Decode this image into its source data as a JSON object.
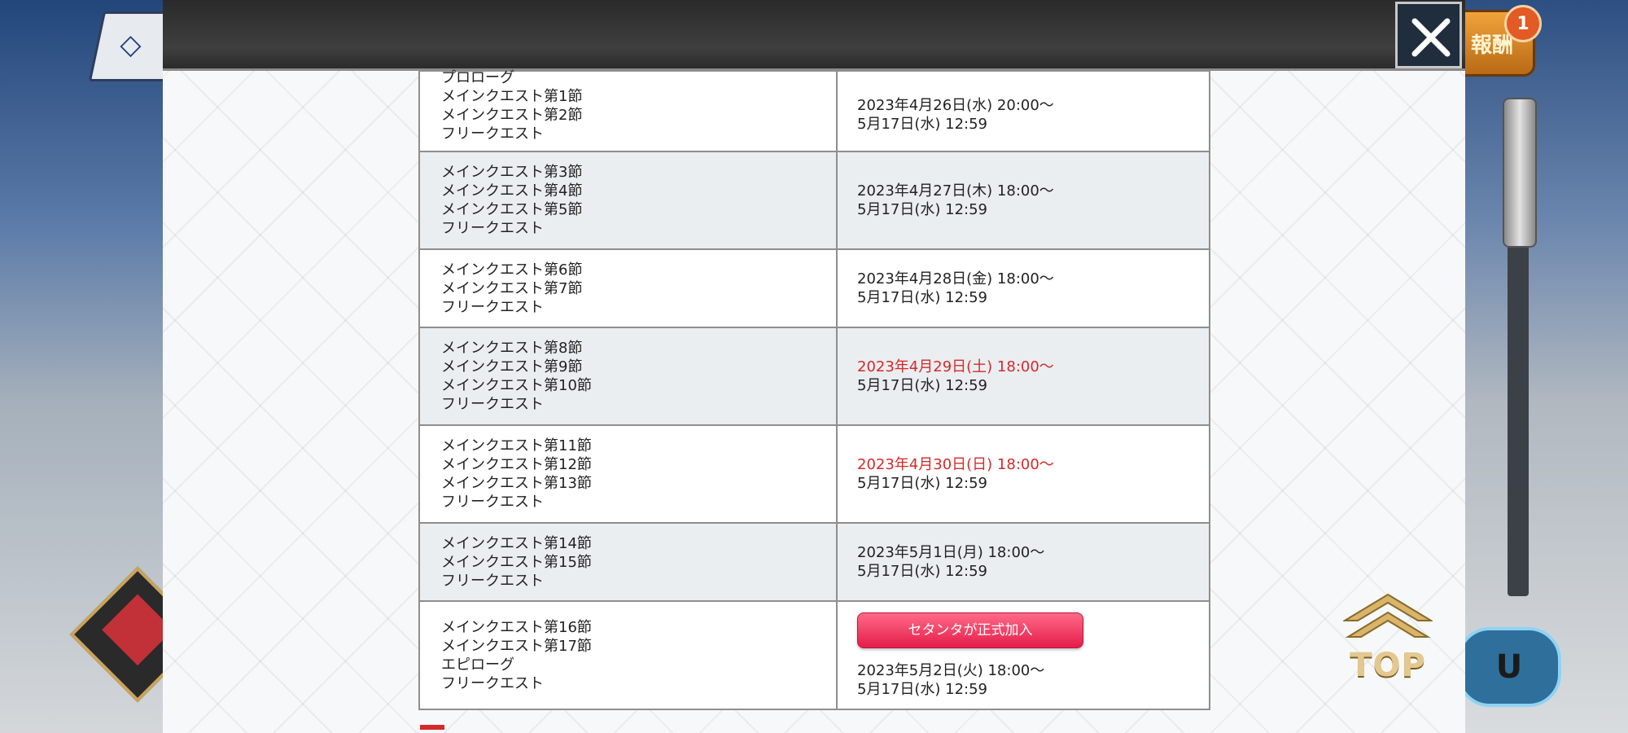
{
  "background": {
    "reward_label": "報酬",
    "reward_badge": "1",
    "menu_label": "U",
    "back_glyph": "◇"
  },
  "modal": {
    "close_icon": "close-x-icon"
  },
  "schedule": {
    "rows": [
      {
        "quests": [
          "プロローグ",
          "メインクエスト第1節",
          "メインクエスト第2節",
          "フリークエスト"
        ],
        "open": "2023年4月26日(水) 20:00〜",
        "close": "5月17日(水) 12:59"
      },
      {
        "quests": [
          "メインクエスト第3節",
          "メインクエスト第4節",
          "メインクエスト第5節",
          "フリークエスト"
        ],
        "open": "2023年4月27日(木) 18:00〜",
        "close": "5月17日(水) 12:59"
      },
      {
        "quests": [
          "メインクエスト第6節",
          "メインクエスト第7節",
          "フリークエスト"
        ],
        "open": "2023年4月28日(金) 18:00〜",
        "close": "5月17日(水) 12:59"
      },
      {
        "quests": [
          "メインクエスト第8節",
          "メインクエスト第9節",
          "メインクエスト第10節",
          "フリークエスト"
        ],
        "open": "2023年4月29日(土) 18:00〜",
        "close": "5月17日(水) 12:59"
      },
      {
        "quests": [
          "メインクエスト第11節",
          "メインクエスト第12節",
          "メインクエスト第13節",
          "フリークエスト"
        ],
        "open": "2023年4月30日(日) 18:00〜",
        "close": "5月17日(水) 12:59"
      },
      {
        "quests": [
          "メインクエスト第14節",
          "メインクエスト第15節",
          "フリークエスト"
        ],
        "open": "2023年5月1日(月) 18:00〜",
        "close": "5月17日(水) 12:59"
      },
      {
        "quests": [
          "メインクエスト第16節",
          "メインクエスト第17節",
          "エピローグ",
          "フリークエスト"
        ],
        "badge": "セタンタが正式加入",
        "open": "2023年5月2日(火) 18:00〜",
        "close": "5月17日(水) 12:59"
      }
    ]
  },
  "top_button": {
    "label": "TOP"
  }
}
